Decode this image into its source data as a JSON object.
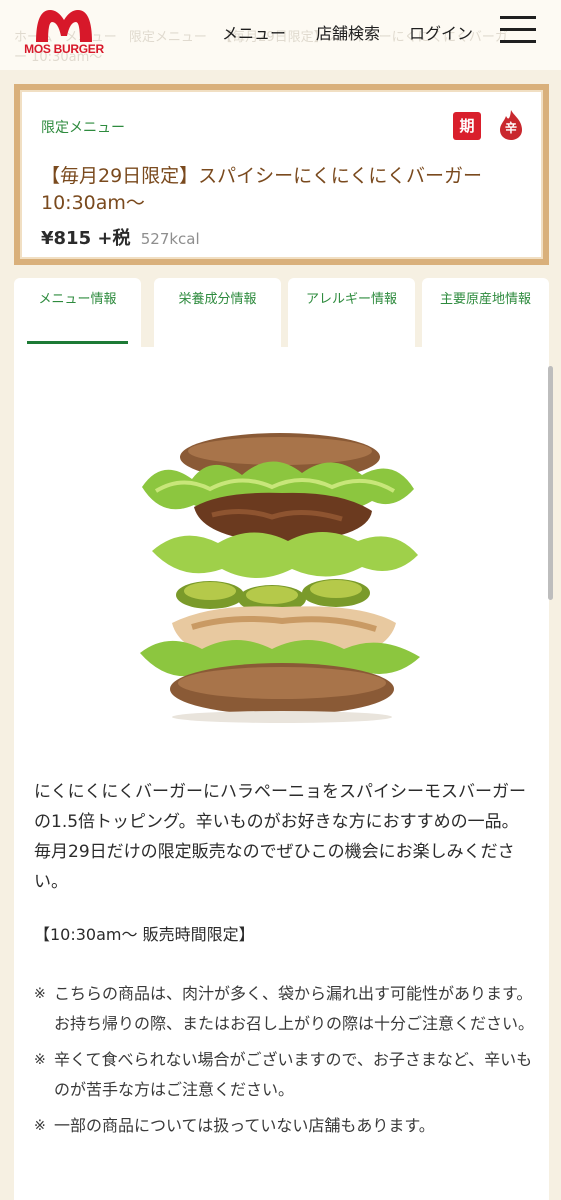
{
  "header": {
    "breadcrumb": [
      "ホーム",
      "メニュー",
      "限定メニュー",
      "【毎月29日限定】スパイシーにくにくにくバーガー 10:30am〜"
    ],
    "logo_text": "MOS BURGER",
    "nav": {
      "menu": "メニュー",
      "store_search": "店舗検索",
      "login": "ログイン"
    },
    "menu_icon": "hamburger-menu-icon"
  },
  "product": {
    "category": "限定メニュー",
    "badge_period": "期",
    "badge_spicy": "辛",
    "name": "【毎月29日限定】スパイシーにくにくにくバーガー 10:30am〜",
    "price": "¥815 +税",
    "kcal": "527kcal"
  },
  "tabs": [
    {
      "label": "メニュー情報",
      "active": true
    },
    {
      "label": "栄養成分情報",
      "active": false
    },
    {
      "label": "アレルギー情報",
      "active": false
    },
    {
      "label": "主要原産地情報",
      "active": false
    }
  ],
  "content": {
    "description": "にくにくにくバーガーにハラペーニョをスパイシーモスバーガーの1.5倍トッピング。辛いものがお好きな方におすすめの一品。毎月29日だけの限定販売なのでぜひこの機会にお楽しみください。",
    "time_note": "【10:30am〜 販売時間限定】",
    "notes": [
      "こちらの商品は、肉汁が多く、袋から漏れ出す可能性があります。お持ち帰りの際、またはお召し上がりの際は十分ご注意ください。",
      "辛くて食べられない場合がございますので、お子さまなど、辛いものが苦手な方はご注意ください。",
      "一部の商品については扱っていない店舗もあります。"
    ],
    "note_mark": "※"
  },
  "colors": {
    "brand_red": "#d7182a",
    "accent_green": "#2e8b3e",
    "frame_tan": "#d9b07b",
    "background": "#f6f0e2"
  }
}
